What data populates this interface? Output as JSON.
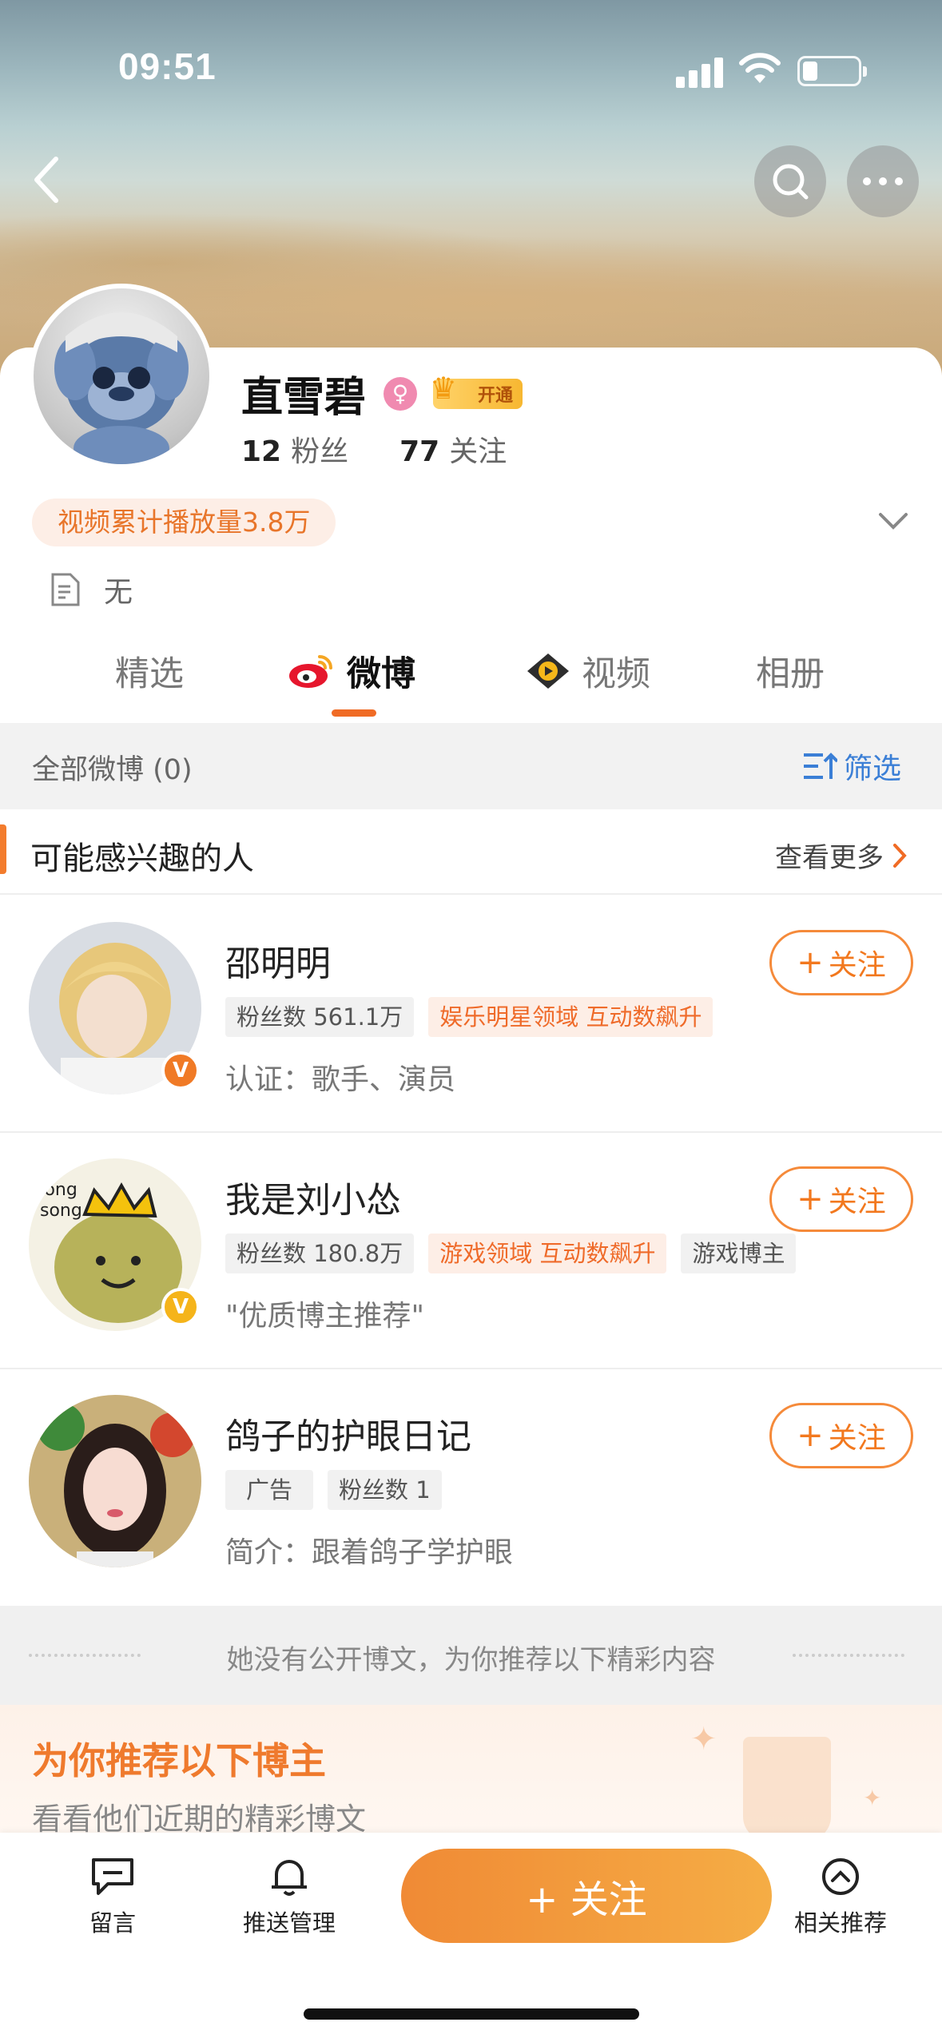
{
  "status_bar": {
    "time": "09:51"
  },
  "profile": {
    "name": "直雪碧",
    "gender_symbol": "♀",
    "vip_label": "开通",
    "fans_count": "12",
    "fans_label": "粉丝",
    "following_count": "77",
    "following_label": "关注",
    "play_badge": "视频累计播放量3.8万",
    "bio": "无"
  },
  "tabs": [
    {
      "label": "精选"
    },
    {
      "label": "微博"
    },
    {
      "label": "视频"
    },
    {
      "label": "相册"
    }
  ],
  "active_tab": "微博",
  "feed_bar": {
    "all_posts": "全部微博 (0)",
    "filter": "筛选"
  },
  "suggestions": {
    "title": "可能感兴趣的人",
    "more": "查看更多",
    "people": [
      {
        "name": "邵明明",
        "tags": [
          {
            "text": "粉丝数 561.1万",
            "style": "gray"
          },
          {
            "text": "娱乐明星领域 互动数飙升",
            "style": "orange"
          }
        ],
        "desc": "认证：歌手、演员",
        "follow": "关注",
        "badge_color": "#f07a26"
      },
      {
        "name": "我是刘小怂",
        "tags": [
          {
            "text": "粉丝数 180.8万",
            "style": "gray"
          },
          {
            "text": "游戏领域 互动数飙升",
            "style": "orange"
          },
          {
            "text": "游戏博主",
            "style": "gray"
          }
        ],
        "desc": "\"优质博主推荐\"",
        "follow": "关注",
        "badge_color": "#f5b41a"
      },
      {
        "name": "鸽子的护眼日记",
        "tags": [
          {
            "text": "广告",
            "style": "gray"
          },
          {
            "text": "粉丝数 1",
            "style": "gray"
          }
        ],
        "desc": "简介：跟着鸽子学护眼",
        "follow": "关注"
      }
    ]
  },
  "no_post_notice": "她没有公开博文，为你推荐以下精彩内容",
  "recommend": {
    "title": "为你推荐以下博主",
    "subtitle": "看看他们近期的精彩博文"
  },
  "bottom_bar": {
    "message": "留言",
    "push": "推送管理",
    "follow": "+ 关注",
    "related": "相关推荐"
  },
  "colors": {
    "accent": "#f06b25",
    "link_blue": "#3b7fd6"
  }
}
